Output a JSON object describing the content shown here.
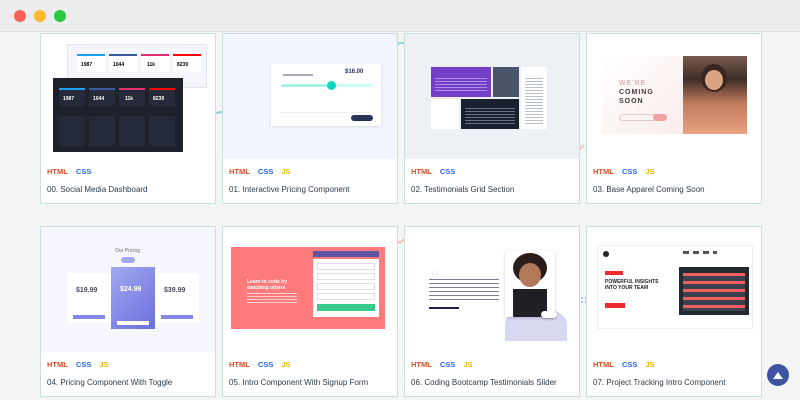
{
  "window": {
    "controls": [
      "close",
      "minimize",
      "maximize"
    ]
  },
  "tags": {
    "html": "HTML",
    "css": "CSS",
    "js": "JS"
  },
  "cards": [
    {
      "title": "00. Social Media Dashboard",
      "has_js": false
    },
    {
      "title": "01. Interactive Pricing Component",
      "has_js": true
    },
    {
      "title": "02. Testimonials Grid Section",
      "has_js": false
    },
    {
      "title": "03. Base Apparel Coming Soon",
      "has_js": true
    },
    {
      "title": "04. Pricing Component With Toggle",
      "has_js": true
    },
    {
      "title": "05. Intro Component With Signup Form",
      "has_js": true
    },
    {
      "title": "06. Coding Bootcamp Testimonials Slider",
      "has_js": true
    },
    {
      "title": "07. Project Tracking Intro Component",
      "has_js": true
    }
  ],
  "thumbs": {
    "dashboard": {
      "stats_light": [
        "1987",
        "1044",
        "11k",
        "8239"
      ],
      "stats_dark": [
        "1987",
        "1044",
        "11k",
        "8239"
      ]
    },
    "pricing": {
      "price": "$16.00"
    },
    "coming_soon": {
      "line1": "WE'RE",
      "line2": "COMING",
      "line3": "SOON"
    },
    "pricing_toggle": {
      "heading": "Our Pricing",
      "prices": [
        "$19.99",
        "$24.99",
        "$39.99"
      ]
    },
    "signup": {
      "heading": "Learn to code by watching others"
    },
    "tracking": {
      "heading": "POWERFUL INSIGHTS INTO YOUR TEAM"
    }
  },
  "colors": {
    "html": "#e34c26",
    "css": "#2965f1",
    "js": "#e6b800",
    "card_border": "#c8dfdc",
    "scroll_button": "#3e54a3"
  },
  "icons": {
    "scroll_top": "arrow-up-icon"
  }
}
